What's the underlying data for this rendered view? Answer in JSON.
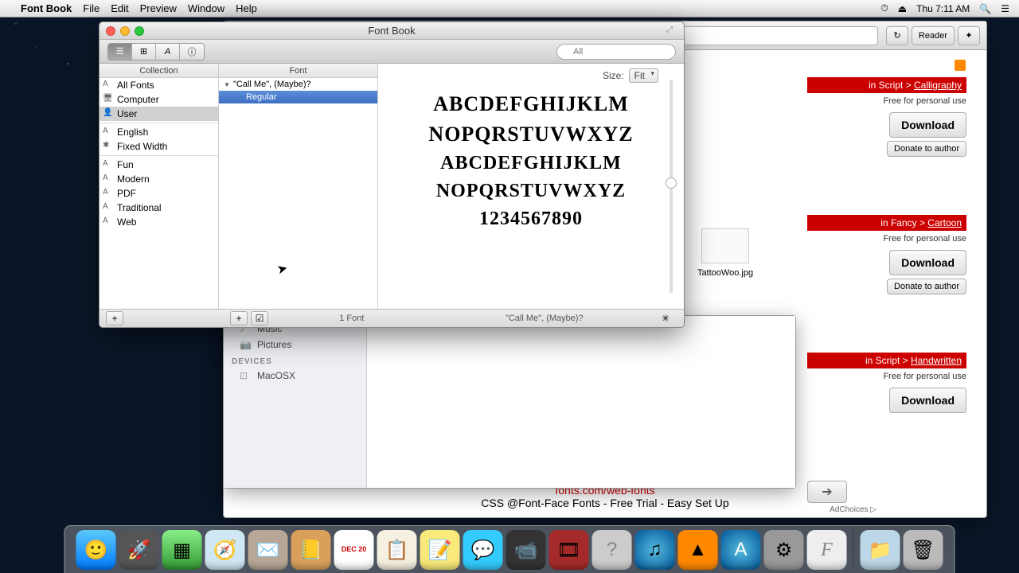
{
  "menubar": {
    "app": "Font Book",
    "items": [
      "File",
      "Edit",
      "Preview",
      "Window",
      "Help"
    ],
    "clock": "Thu 7:11 AM"
  },
  "safari": {
    "toolbar": {
      "reader": "Reader"
    },
    "rss": "RSS",
    "blocks": [
      {
        "in": "in Script > ",
        "cat": "Calligraphy",
        "free": "Free for personal use",
        "dl": "Download",
        "donate": "Donate to author"
      },
      {
        "in": "in Fancy > ",
        "cat": "Cartoon",
        "free": "Free for personal use",
        "dl": "Download",
        "donate": "Donate to author"
      },
      {
        "in": "in Script > ",
        "cat": "Handwritten",
        "free": "Free for personal use",
        "dl": "Download"
      }
    ],
    "file_name": "TattooWoo.jpg",
    "footer_link": "fonts.com/web-fonts",
    "footer_text": "CSS @Font-Face Fonts - Free Trial - Easy Set Up",
    "adchoices": "AdChoices",
    "next": "➔"
  },
  "finder": {
    "items": [
      "Music",
      "Pictures"
    ],
    "devices_heading": "DEVICES",
    "device": "MacOSX"
  },
  "fontbook": {
    "title": "Font Book",
    "search_placeholder": "All",
    "col_collection": "Collection",
    "col_font": "Font",
    "collections": [
      {
        "icon": "A",
        "label": "All Fonts"
      },
      {
        "icon": "🖥",
        "label": "Computer"
      },
      {
        "icon": "👤",
        "label": "User",
        "selected": true
      }
    ],
    "collections2": [
      {
        "icon": "A",
        "label": "English"
      },
      {
        "icon": "✱",
        "label": "Fixed Width"
      }
    ],
    "collections3": [
      {
        "icon": "A",
        "label": "Fun"
      },
      {
        "icon": "A",
        "label": "Modern"
      },
      {
        "icon": "A",
        "label": "PDF"
      },
      {
        "icon": "A",
        "label": "Traditional"
      },
      {
        "icon": "A",
        "label": "Web"
      }
    ],
    "font_name": "\"Call Me\", (Maybe)?",
    "font_style": "Regular",
    "size_label": "Size:",
    "size_value": "Fit",
    "sample": {
      "l1": "ABCDEFGHIJKLM",
      "l2": "NOPQRSTUVWXYZ",
      "l3": "ABCDEFGHIJKLM",
      "l4": "NOPQRSTUVWXYZ",
      "l5": "1234567890"
    },
    "footer_count": "1 Font",
    "footer_name": "\"Call Me\", (Maybe)?"
  },
  "dock": {
    "apps": [
      "finder",
      "launchpad",
      "mission-control",
      "safari",
      "mail",
      "contacts",
      "calendar",
      "reminders",
      "notes",
      "messages",
      "facetime",
      "photo-booth",
      "help",
      "itunes",
      "vlc",
      "app-store",
      "settings",
      "fontbook",
      "documents",
      "trash"
    ],
    "cal_day": "DEC 20"
  }
}
